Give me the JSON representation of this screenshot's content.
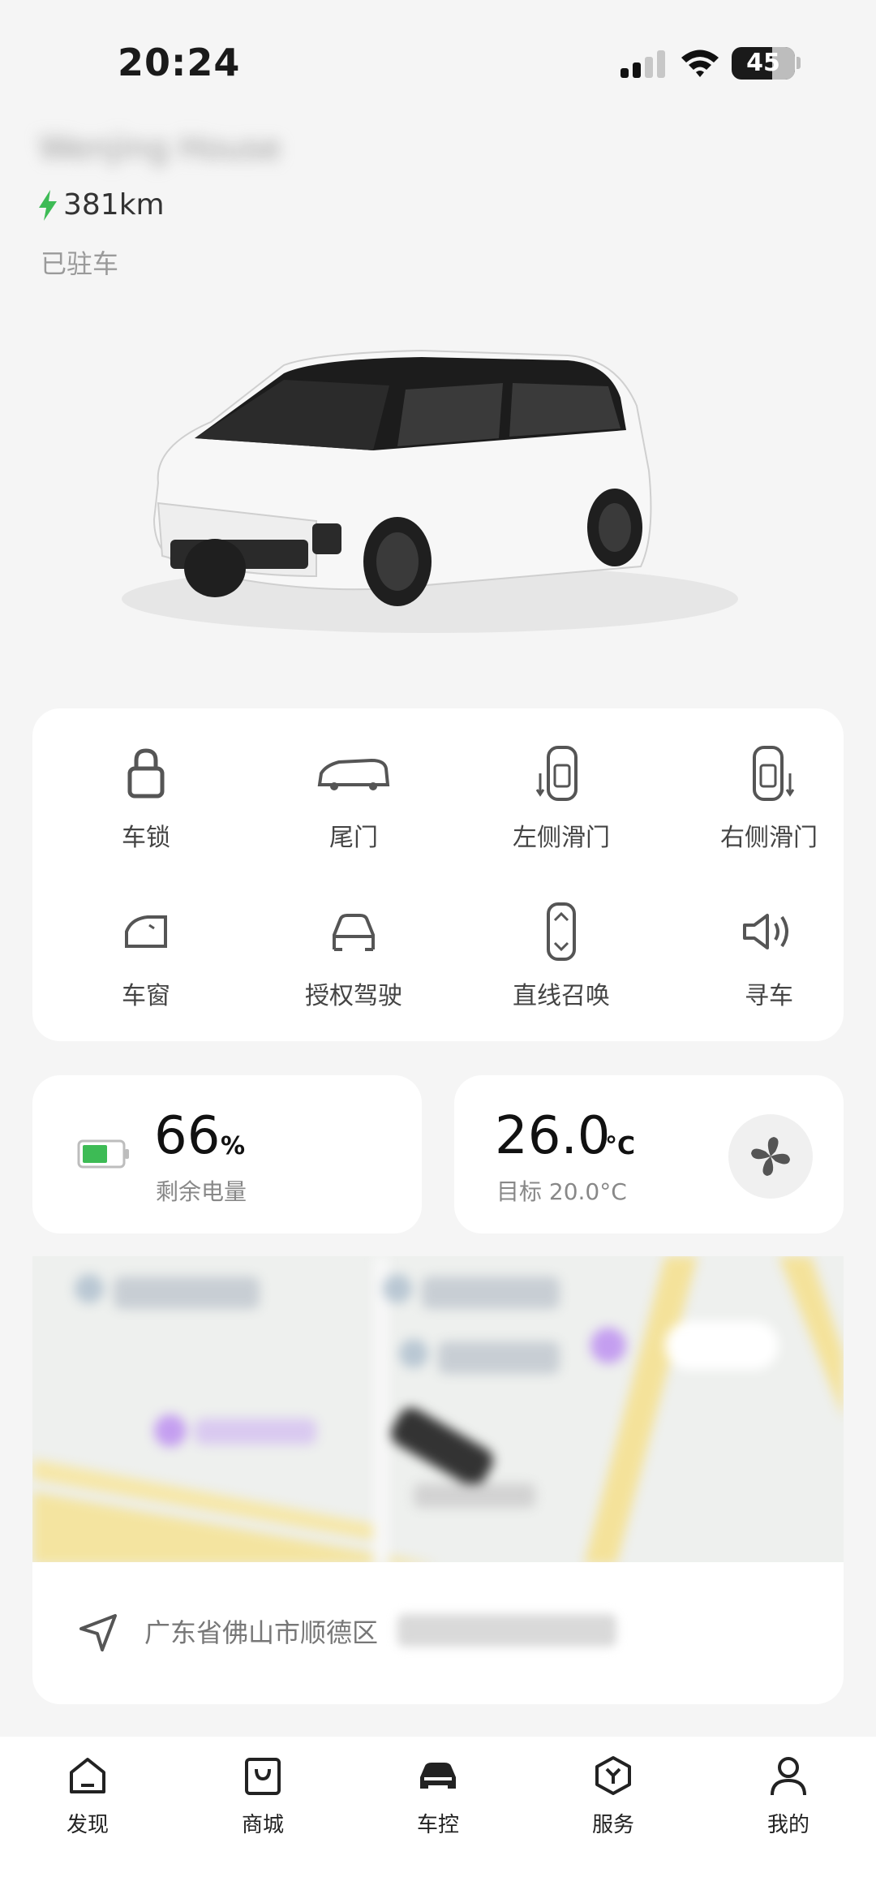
{
  "status_bar": {
    "time": "20:24",
    "battery_level": "45"
  },
  "vehicle": {
    "name": "Wenjing House",
    "range": "381km",
    "status": "已驻车"
  },
  "controls": [
    {
      "label": "车锁",
      "icon": "lock-icon"
    },
    {
      "label": "尾门",
      "icon": "tailgate-icon"
    },
    {
      "label": "左侧滑门",
      "icon": "left-sliding-door-icon"
    },
    {
      "label": "右侧滑门",
      "icon": "right-sliding-door-icon"
    },
    {
      "label": "车窗",
      "icon": "window-icon"
    },
    {
      "label": "授权驾驶",
      "icon": "authorized-driving-icon"
    },
    {
      "label": "直线召唤",
      "icon": "straight-summon-icon"
    },
    {
      "label": "寻车",
      "icon": "find-car-icon"
    }
  ],
  "battery": {
    "value": "66",
    "unit": "%",
    "label": "剩余电量",
    "level": 0.66
  },
  "climate": {
    "value": "26.0",
    "unit": "°C",
    "target": "目标 20.0°C"
  },
  "location": {
    "address": "广东省佛山市顺德区"
  },
  "tabs": [
    {
      "label": "发现",
      "icon": "home-icon"
    },
    {
      "label": "商城",
      "icon": "shop-bag-icon"
    },
    {
      "label": "车控",
      "icon": "car-icon"
    },
    {
      "label": "服务",
      "icon": "service-icon"
    },
    {
      "label": "我的",
      "icon": "profile-icon"
    }
  ],
  "colors": {
    "accent_green": "#3dbb55",
    "background": "#f5f5f5",
    "card": "#ffffff"
  }
}
